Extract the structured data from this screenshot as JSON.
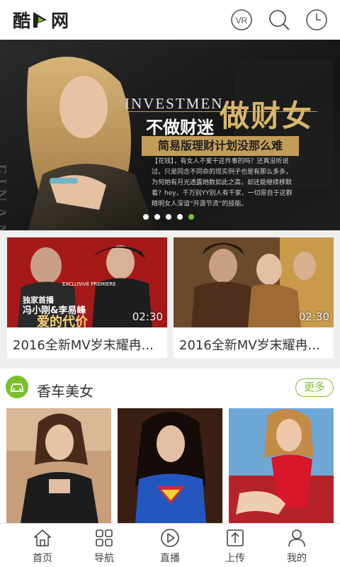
{
  "header": {
    "logo_text_1": "酷",
    "logo_text_2": "网",
    "icons": [
      "vr-icon",
      "search-icon",
      "history-clock-icon"
    ],
    "vr_label": "VR"
  },
  "banner": {
    "vertical_text": "FINANCE",
    "investmen": "INVESTMEN",
    "slogan_small": "不做财迷",
    "slogan_big": "做财女",
    "subtitle": "简易版理财计划没那么难",
    "body": "【花钱】，有女人不爱干这件事的吗？还真没听说过。只是同念不同命的现实例子也是有那么多多，为何她有月光透露她数如此之高，却还能继续移默着？hey，千万别YY别人有千家，一切原自于这群精明女人深谙“开源节流”的技能。",
    "slides_total": 5,
    "slide_active_index": 4,
    "colors": {
      "accent": "#7cc12d",
      "gold": "#c39d57"
    }
  },
  "videos": [
    {
      "title": "2016全新MV岁末耀冉...",
      "duration": "02:30",
      "poster_text_1": "独家首播",
      "poster_text_2": "冯小刚&李易峰",
      "poster_text_3": "爱的代价",
      "poster_text_4": "EXCLUSIVE PREMIERE"
    },
    {
      "title": "2016全新MV岁末耀冉...",
      "duration": "02:30"
    }
  ],
  "section": {
    "title": "香车美女",
    "more_label": "更多",
    "icon": "car-icon",
    "photos": 3
  },
  "bottom_nav": [
    {
      "label": "首页",
      "icon": "home-icon"
    },
    {
      "label": "导航",
      "icon": "grid-icon"
    },
    {
      "label": "直播",
      "icon": "play-icon"
    },
    {
      "label": "上传",
      "icon": "upload-icon"
    },
    {
      "label": "我的",
      "icon": "user-icon"
    }
  ]
}
